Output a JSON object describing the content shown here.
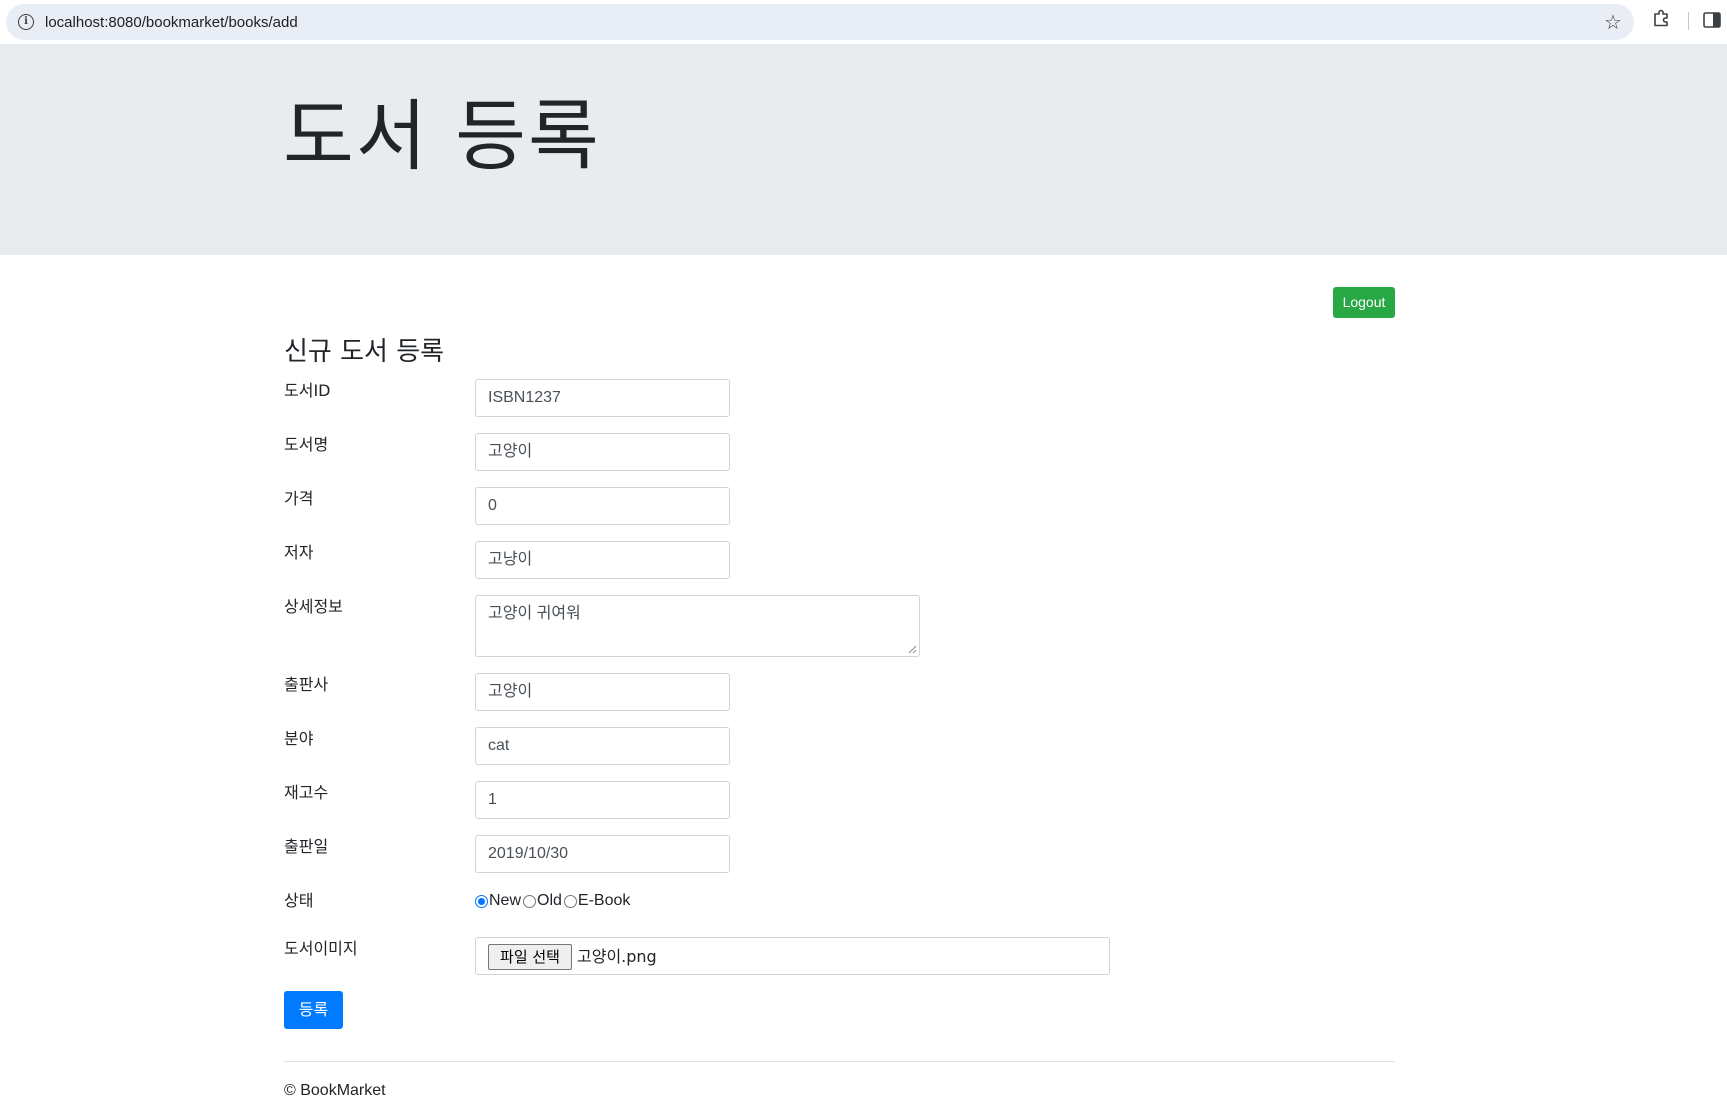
{
  "browser": {
    "url": "localhost:8080/bookmarket/books/add",
    "icons": [
      "site-info-icon",
      "star-icon",
      "extensions-icon",
      "side-panel-icon"
    ]
  },
  "jumbotron": {
    "title": "도서 등록"
  },
  "header": {
    "logout_label": "Logout",
    "logout_color": "#28a745"
  },
  "form": {
    "heading": "신규 도서 등록",
    "fields": {
      "book_id": {
        "label": "도서ID",
        "value": "ISBN1237"
      },
      "name": {
        "label": "도서명",
        "value": "고양이"
      },
      "price": {
        "label": "가격",
        "value": "0"
      },
      "author": {
        "label": "저자",
        "value": "고냥이"
      },
      "description": {
        "label": "상세정보",
        "value": "고양이 귀여워"
      },
      "publisher": {
        "label": "출판사",
        "value": "고양이"
      },
      "category": {
        "label": "분야",
        "value": "cat"
      },
      "units_in_stock": {
        "label": "재고수",
        "value": "1"
      },
      "release_date": {
        "label": "출판일",
        "value": "2019/10/30"
      },
      "condition": {
        "label": "상태",
        "options": [
          "New",
          "Old",
          "E-Book"
        ],
        "selected": "New"
      },
      "image": {
        "label": "도서이미지",
        "button_label": "파일 선택",
        "file_name": "고양이.png"
      }
    },
    "submit_label": "등록",
    "submit_color": "#007bff"
  },
  "footer": {
    "text": "© BookMarket"
  }
}
